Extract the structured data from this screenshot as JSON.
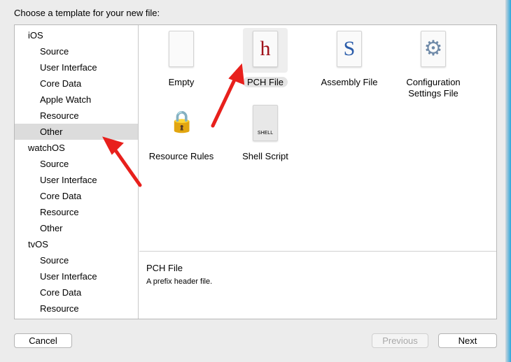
{
  "dialog": {
    "title": "Choose a template for your new file:"
  },
  "sidebar": {
    "items": [
      {
        "label": "iOS",
        "group": true
      },
      {
        "label": "Source"
      },
      {
        "label": "User Interface"
      },
      {
        "label": "Core Data"
      },
      {
        "label": "Apple Watch"
      },
      {
        "label": "Resource"
      },
      {
        "label": "Other",
        "selected": true
      },
      {
        "label": "watchOS",
        "group": true
      },
      {
        "label": "Source"
      },
      {
        "label": "User Interface"
      },
      {
        "label": "Core Data"
      },
      {
        "label": "Resource"
      },
      {
        "label": "Other"
      },
      {
        "label": "tvOS",
        "group": true
      },
      {
        "label": "Source"
      },
      {
        "label": "User Interface"
      },
      {
        "label": "Core Data"
      },
      {
        "label": "Resource"
      }
    ]
  },
  "templates": [
    {
      "label": "Empty",
      "icon": "empty-file-icon",
      "glyph": ""
    },
    {
      "label": "PCH File",
      "icon": "header-file-icon",
      "glyph": "h",
      "selected": true
    },
    {
      "label": "Assembly File",
      "icon": "assembly-file-icon",
      "glyph": "S"
    },
    {
      "label": "Configuration Settings File",
      "icon": "config-gear-icon",
      "glyph": "⚙"
    },
    {
      "label": "Resource Rules",
      "icon": "padlocks-icon",
      "glyph": "🔒"
    },
    {
      "label": "Shell Script",
      "icon": "shell-script-icon",
      "glyph": "SHELL"
    }
  ],
  "description": {
    "title": "PCH File",
    "text": "A prefix header file."
  },
  "buttons": {
    "cancel": "Cancel",
    "previous": "Previous",
    "next": "Next"
  },
  "colors": {
    "arrow": "#e8201c",
    "header_glyph": "#a0121a",
    "asm_glyph": "#2a5caa"
  }
}
